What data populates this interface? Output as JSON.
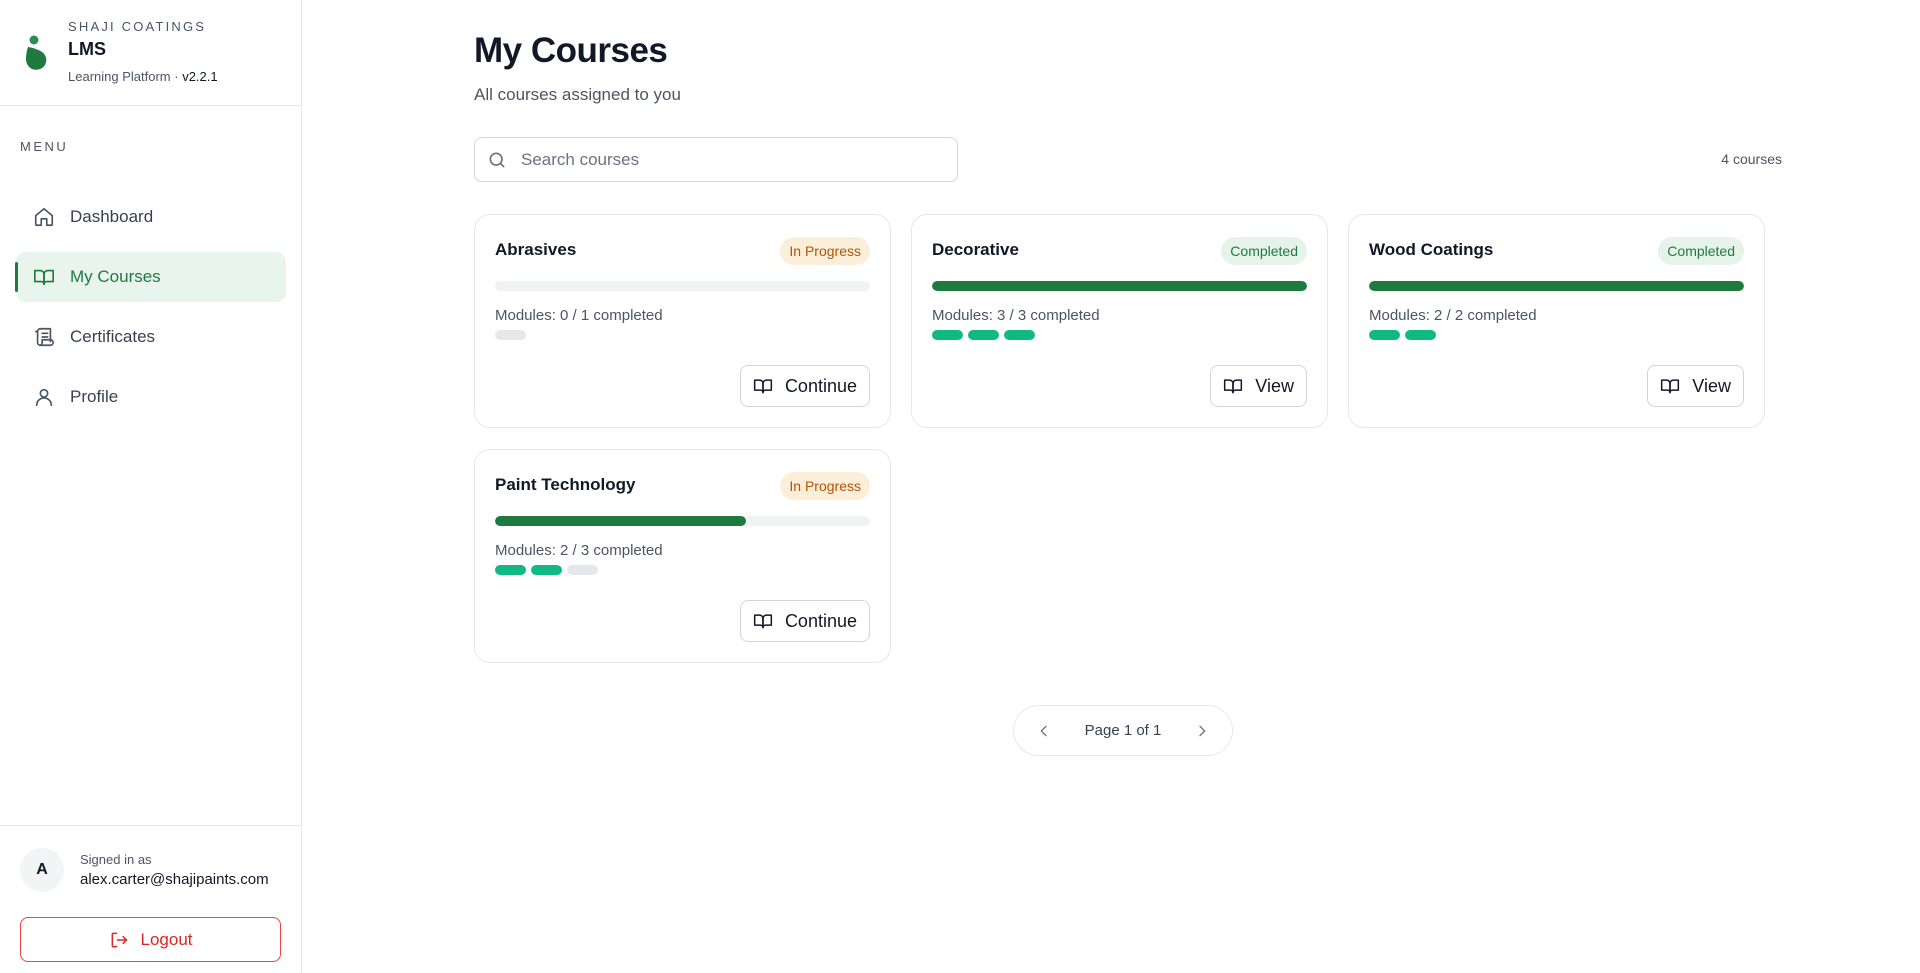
{
  "brand": {
    "company": "SHAJI COATINGS",
    "name": "LMS",
    "subtitle": "Learning Platform",
    "separator": " · ",
    "version": "v2.2.1",
    "logo_color": "#1f7a3f"
  },
  "sidebar": {
    "menu_label": "MENU",
    "items": [
      {
        "label": "Dashboard",
        "icon": "home-icon",
        "active": false
      },
      {
        "label": "My Courses",
        "icon": "book-open-icon",
        "active": true
      },
      {
        "label": "Certificates",
        "icon": "scroll-icon",
        "active": false
      },
      {
        "label": "Profile",
        "icon": "user-icon",
        "active": false
      }
    ]
  },
  "user": {
    "avatar_initial": "A",
    "signed_in_label": "Signed in as",
    "email": "alex.carter@shajipaints.com",
    "logout_label": "Logout"
  },
  "main": {
    "title": "My Courses",
    "subtitle": "All courses assigned to you",
    "search_placeholder": "Search courses",
    "search_value": "",
    "course_count": "4 courses"
  },
  "courses": [
    {
      "title": "Abrasives",
      "status": "In Progress",
      "progress": 0.0,
      "modules_text": "Modules: 0 / 1 completed",
      "modules_total": 1,
      "modules_done": 0,
      "action": "Continue"
    },
    {
      "title": "Decorative",
      "status": "Completed",
      "progress": 1.0,
      "modules_text": "Modules: 3 / 3 completed",
      "modules_total": 3,
      "modules_done": 3,
      "action": "View"
    },
    {
      "title": "Wood Coatings",
      "status": "Completed",
      "progress": 1.0,
      "modules_text": "Modules: 2 / 2 completed",
      "modules_total": 2,
      "modules_done": 2,
      "action": "View"
    },
    {
      "title": "Paint Technology",
      "status": "In Progress",
      "progress": 0.67,
      "modules_text": "Modules: 2 / 3 completed",
      "modules_total": 3,
      "modules_done": 2,
      "action": "Continue"
    }
  ],
  "pagination": {
    "text": "Page 1 of 1"
  },
  "colors": {
    "accent": "#1f7a3f",
    "module_done": "#10b981",
    "in_progress_badge_bg": "#fbefd9",
    "in_progress_badge_text": "#b45309",
    "completed_badge_bg": "#e6f3ea",
    "completed_badge_text": "#1f7a3f",
    "logout": "#dc2626"
  }
}
